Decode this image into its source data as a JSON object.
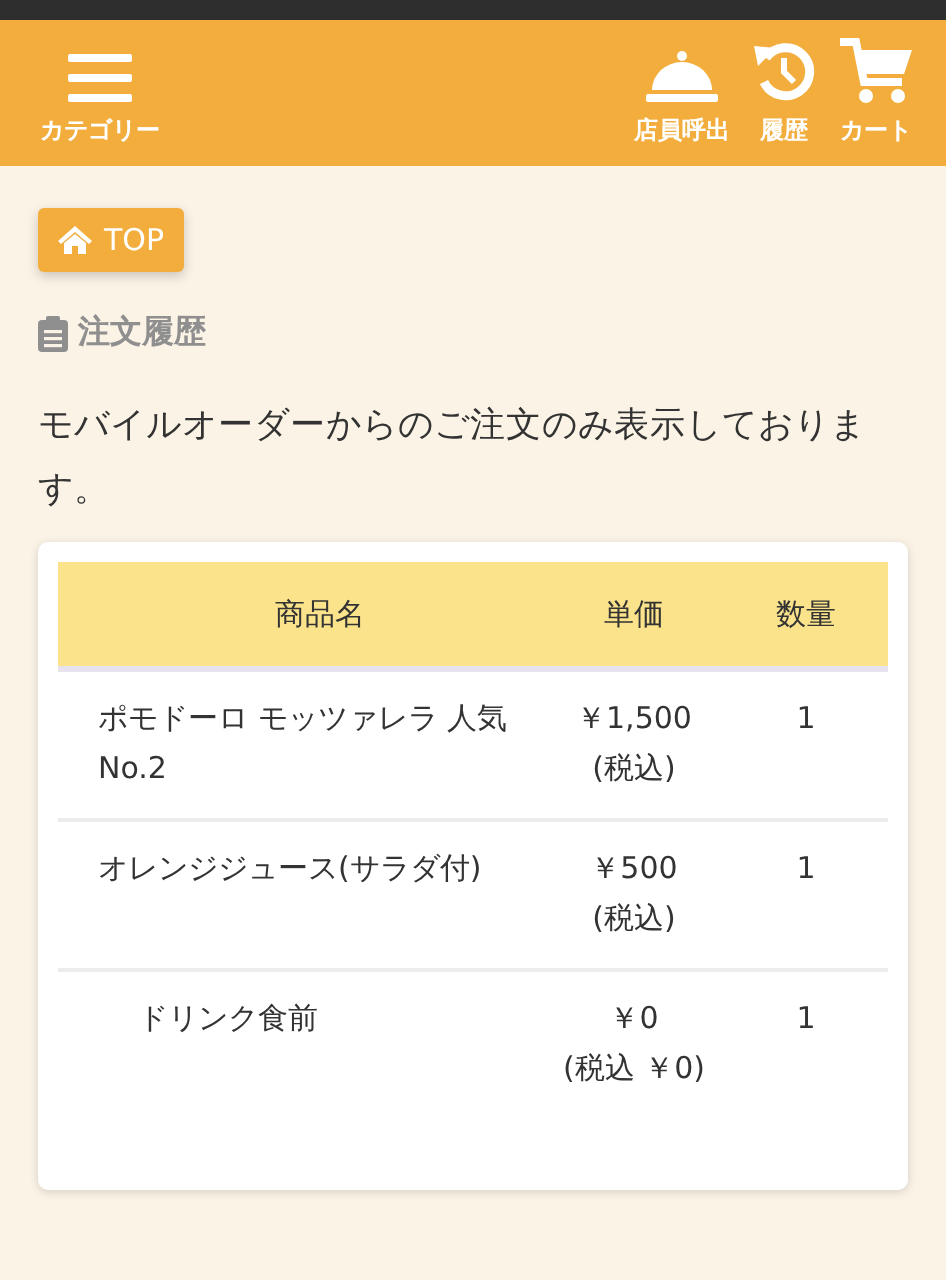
{
  "header": {
    "menu_label": "カテゴリー",
    "actions": [
      {
        "kind": "bell",
        "label": "店員呼出"
      },
      {
        "kind": "history",
        "label": "履歴"
      },
      {
        "kind": "cart",
        "label": "カート"
      }
    ]
  },
  "top_button": "TOP",
  "heading": "注文履歴",
  "notice": "モバイルオーダーからのご注文のみ表示しております。",
  "table": {
    "columns": [
      "商品名",
      "単価",
      "数量"
    ],
    "rows": [
      {
        "kind": "item",
        "name": "ポモドーロ モッツァレラ 人気No.2",
        "price": "￥1,500",
        "tax": "(税込)",
        "qty": "1"
      },
      {
        "kind": "item",
        "name": "オレンジジュース(サラダ付)",
        "price": "￥500",
        "tax": "(税込)",
        "qty": "1"
      },
      {
        "kind": "option",
        "name": "ドリンク食前",
        "price": "￥0",
        "tax": "(税込 ￥0)",
        "qty": "1"
      }
    ]
  }
}
